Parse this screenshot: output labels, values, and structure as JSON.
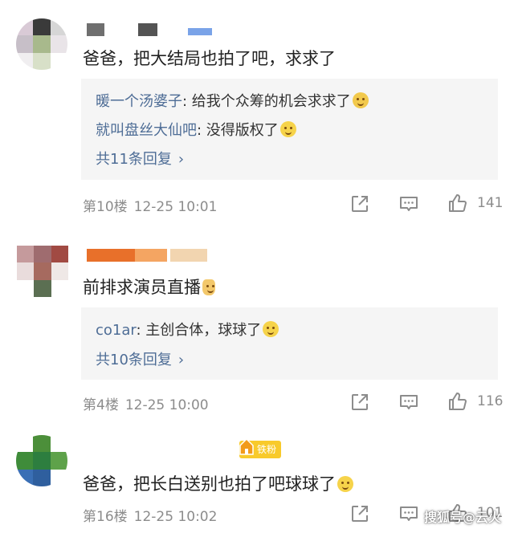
{
  "comments": [
    {
      "text": "爸爸，把大结局也拍了吧，求求了",
      "replies": [
        {
          "user": "暖一个汤婆子",
          "sep": ":",
          "text": " 给我个众筹的机会求求了"
        },
        {
          "user": "就叫盘丝大仙吧",
          "sep": ":",
          "text": " 没得版权了"
        }
      ],
      "reply_count": "共11条回复",
      "floor": "第10楼",
      "time": "12-25 10:01",
      "likes": "141",
      "accent_colors": [
        "#7d7d7d",
        "#5d5d5d",
        "#6a8dd8"
      ]
    },
    {
      "text": "前排求演员直播",
      "replies": [
        {
          "user": "co1ar",
          "sep": ":",
          "text": " 主创合体，球球了"
        }
      ],
      "reply_count": "共10条回复",
      "floor": "第4楼",
      "time": "12-25 10:00",
      "likes": "116",
      "accent_colors": [
        "#e8702a",
        "#f4a562",
        "#f2d5b0"
      ]
    },
    {
      "text": "爸爸，把长白送别也拍了吧球球了",
      "badge": "铁粉",
      "floor": "第16楼",
      "time": "12-25 10:02",
      "likes": "101",
      "accent_colors": [
        "#4c8f3a",
        "#2d7e3f",
        "#3a6fb5"
      ]
    }
  ],
  "icons": {
    "share": "share-icon",
    "comment": "comment-icon",
    "like": "thumbs-up-icon",
    "reply_chevron": "chevron-right-icon"
  },
  "watermark": "搜狐号@云火",
  "colors": {
    "link_blue": "#4e6d96",
    "meta_gray": "#8c8c8c",
    "reply_bg": "#f5f5f5",
    "badge_yellow": "#f8ca2b"
  }
}
